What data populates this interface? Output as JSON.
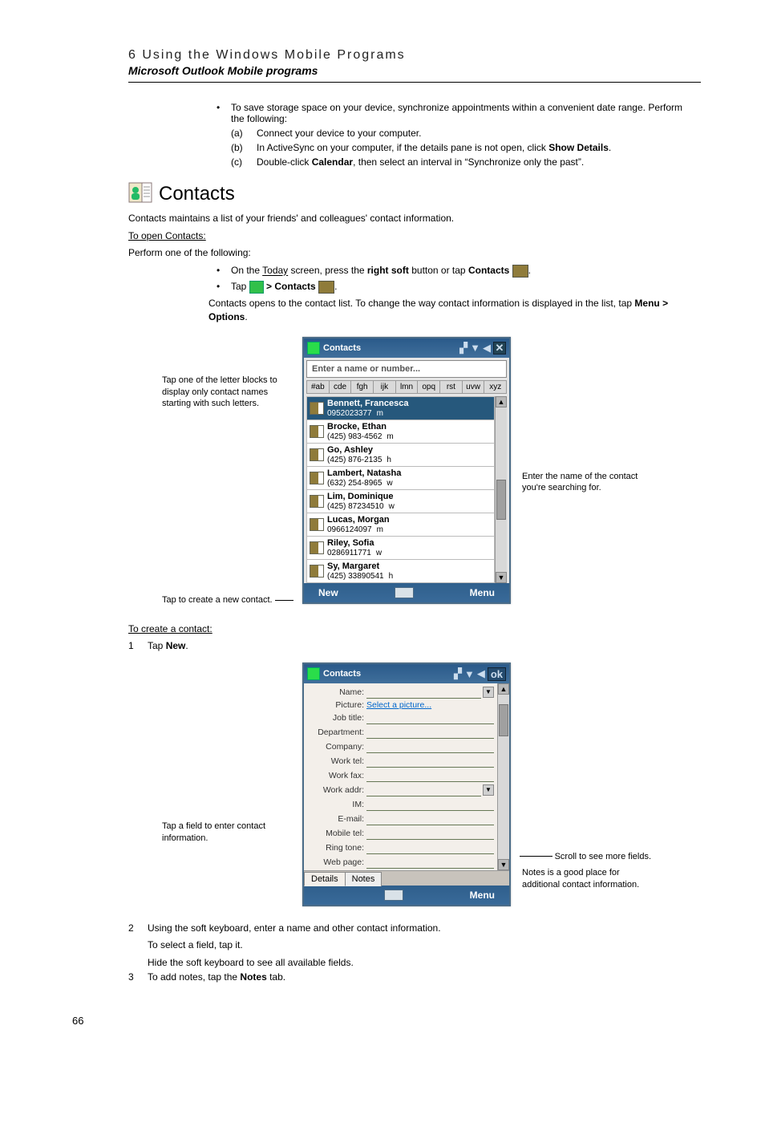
{
  "header": {
    "chapter": "6 Using the Windows Mobile Programs",
    "subtitle": "Microsoft Outlook Mobile programs"
  },
  "intro_bullet": "To save storage space on your device, synchronize appointments within a convenient date range. Perform the following:",
  "intro_steps": [
    {
      "lbl": "(a)",
      "text": "Connect your device to your computer."
    },
    {
      "lbl": "(b)",
      "text_pre": "In ActiveSync on your computer, if the details pane is not open, click ",
      "bold": "Show Details",
      "text_post": "."
    },
    {
      "lbl": "(c)",
      "text_pre": "Double-click ",
      "bold": "Calendar",
      "text_post": ", then select an interval in “Synchronize only the past”."
    }
  ],
  "contacts": {
    "title": "Contacts",
    "desc": "Contacts maintains a list of your friends' and colleagues' contact information.",
    "open_h": "To open Contacts:",
    "open_sub": "Perform one of the following:",
    "open_opt1_pre": "On the ",
    "open_opt1_u": "Today",
    "open_opt1_mid": " screen, press the ",
    "open_opt1_b1": "right soft",
    "open_opt1_mid2": " button or tap ",
    "open_opt1_b2": "Contacts",
    "open_opt2_pre": "Tap ",
    "open_opt2_mid": " > ",
    "open_opt2_b": "Contacts",
    "open_result": "Contacts opens to the contact list. To change the way contact information is displayed in the list, tap ",
    "open_result_b": "Menu > Options",
    "callout_letter": "Tap one of the letter blocks to display only contact names starting with such letters.",
    "callout_new": "Tap to create a new contact.",
    "callout_search": "Enter the name of the contact you're searching for."
  },
  "screen1": {
    "tb_title": "Contacts",
    "search_ph": "Enter a name or number...",
    "letters": [
      "#ab",
      "cde",
      "fgh",
      "ijk",
      "lmn",
      "opq",
      "rst",
      "uvw",
      "xyz"
    ],
    "rows": [
      {
        "name": "Bennett, Francesca",
        "sub": "0952023377",
        "tag": "m",
        "sel": true
      },
      {
        "name": "Brocke, Ethan",
        "sub": "(425) 983-4562",
        "tag": "m"
      },
      {
        "name": "Go, Ashley",
        "sub": "(425) 876-2135",
        "tag": "h"
      },
      {
        "name": "Lambert, Natasha",
        "sub": "(632) 254-8965",
        "tag": "w"
      },
      {
        "name": "Lim, Dominique",
        "sub": "(425) 87234510",
        "tag": "w"
      },
      {
        "name": "Lucas, Morgan",
        "sub": "0966124097",
        "tag": "m"
      },
      {
        "name": "Riley, Sofia",
        "sub": "0286911771",
        "tag": "w"
      },
      {
        "name": "Sy, Margaret",
        "sub": "(425) 33890541",
        "tag": "h"
      }
    ],
    "soft_left": "New",
    "soft_right": "Menu"
  },
  "create": {
    "h": "To create a contact:",
    "step1_pre": "Tap ",
    "step1_b": "New",
    "step2": "Using the soft keyboard, enter a name and other contact information.",
    "step2b": "To select a field, tap it.",
    "step2c": "Hide the soft keyboard to see all available fields.",
    "step3_pre": "To add notes, tap the ",
    "step3_b": "Notes",
    "step3_post": " tab.",
    "callout_field": "Tap a field to enter contact information.",
    "callout_scroll": "Scroll to see more fields.",
    "callout_notes": "Notes is a good place for additional contact information."
  },
  "screen2": {
    "tb_title": "Contacts",
    "tb_ok": "ok",
    "picture_link": "Select a picture...",
    "fields": [
      "Name:",
      "Picture:",
      "Job title:",
      "Department:",
      "Company:",
      "Work tel:",
      "Work fax:",
      "Work addr:",
      "IM:",
      "E-mail:",
      "Mobile tel:",
      "Ring tone:",
      "Web page:"
    ],
    "tab_details": "Details",
    "tab_notes": "Notes",
    "soft_right": "Menu"
  },
  "pagenum": "66"
}
